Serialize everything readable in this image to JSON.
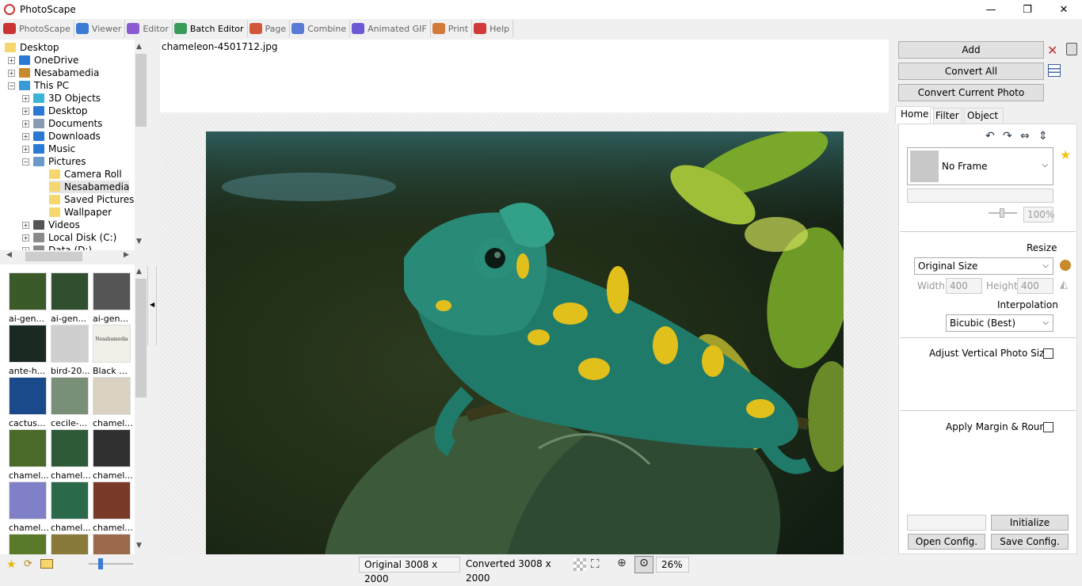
{
  "window": {
    "title": "PhotoScape",
    "minimize_glyph": "—",
    "maximize_glyph": "❐",
    "close_glyph": "✕"
  },
  "tabs": [
    {
      "label": "PhotoScape",
      "icon": "photoscape-icon",
      "color": "#cc3333"
    },
    {
      "label": "Viewer",
      "icon": "viewer-icon",
      "color": "#3a7bd5"
    },
    {
      "label": "Editor",
      "icon": "editor-icon",
      "color": "#8a5bd1"
    },
    {
      "label": "Batch Editor",
      "icon": "batch-editor-icon",
      "color": "#3a9b5a"
    },
    {
      "label": "Page",
      "icon": "page-icon",
      "color": "#d1573a"
    },
    {
      "label": "Combine",
      "icon": "combine-icon",
      "color": "#5a7bd5"
    },
    {
      "label": "Animated GIF",
      "icon": "animated-gif-icon",
      "color": "#6a5ad5"
    },
    {
      "label": "Print",
      "icon": "print-icon",
      "color": "#d17a3a"
    },
    {
      "label": "Help",
      "icon": "help-icon",
      "color": "#d13a3a"
    }
  ],
  "active_tab": "Batch Editor",
  "folder_tree": [
    {
      "label": "Desktop",
      "level": 0,
      "icon": "folder-icon",
      "expander": ""
    },
    {
      "label": "OneDrive",
      "level": 1,
      "icon": "cloud-icon",
      "expander": "+"
    },
    {
      "label": "Nesabamedia",
      "level": 1,
      "icon": "user-icon",
      "expander": "+"
    },
    {
      "label": "This PC",
      "level": 1,
      "icon": "computer-icon",
      "expander": "−"
    },
    {
      "label": "3D Objects",
      "level": 2,
      "icon": "3d-objects-icon",
      "expander": "+"
    },
    {
      "label": "Desktop",
      "level": 2,
      "icon": "desktop-icon",
      "expander": "+"
    },
    {
      "label": "Documents",
      "level": 2,
      "icon": "documents-icon",
      "expander": "+"
    },
    {
      "label": "Downloads",
      "level": 2,
      "icon": "downloads-icon",
      "expander": "+"
    },
    {
      "label": "Music",
      "level": 2,
      "icon": "music-icon",
      "expander": "+"
    },
    {
      "label": "Pictures",
      "level": 2,
      "icon": "pictures-icon",
      "expander": "−"
    },
    {
      "label": "Camera Roll",
      "level": 3,
      "icon": "folder-icon",
      "expander": ""
    },
    {
      "label": "Nesabamedia",
      "level": 3,
      "icon": "folder-icon",
      "expander": "",
      "selected": true
    },
    {
      "label": "Saved Pictures",
      "level": 3,
      "icon": "folder-icon",
      "expander": ""
    },
    {
      "label": "Wallpaper",
      "level": 3,
      "icon": "folder-icon",
      "expander": ""
    },
    {
      "label": "Videos",
      "level": 2,
      "icon": "videos-icon",
      "expander": "+"
    },
    {
      "label": "Local Disk (C:)",
      "level": 2,
      "icon": "drive-icon",
      "expander": "+"
    },
    {
      "label": "Data (D:)",
      "level": 2,
      "icon": "drive-icon",
      "expander": "+"
    }
  ],
  "thumbnails": [
    {
      "label": "ai-gen...",
      "tone": "#3b5a2a"
    },
    {
      "label": "ai-gen...",
      "tone": "#2f4f2f"
    },
    {
      "label": "ai-gen...",
      "tone": "#555555"
    },
    {
      "label": "ante-h...",
      "tone": "#1a2a22"
    },
    {
      "label": "bird-20...",
      "tone": "#cfcfcf"
    },
    {
      "label": "Black ...",
      "tone": "#f2efe8",
      "caption": "Nesabamedia"
    },
    {
      "label": "cactus...",
      "tone": "#1a4a8a"
    },
    {
      "label": "cecile-...",
      "tone": "#7a8f78"
    },
    {
      "label": "chamel...",
      "tone": "#d9d2c2"
    },
    {
      "label": "chamel...",
      "tone": "#4a6a2a"
    },
    {
      "label": "chamel...",
      "tone": "#2e5a3a"
    },
    {
      "label": "chamel...",
      "tone": "#303030"
    },
    {
      "label": "chamel...",
      "tone": "#8080c8"
    },
    {
      "label": "chamel...",
      "tone": "#2a6a4a"
    },
    {
      "label": "chamel...",
      "tone": "#7a3a2a"
    },
    {
      "label": "",
      "tone": "#5a7a2a"
    },
    {
      "label": "",
      "tone": "#8a7a3a"
    },
    {
      "label": "",
      "tone": "#9a6a4a"
    }
  ],
  "preview": {
    "filename": "chameleon-4501712.jpg"
  },
  "status": {
    "original": "Original 3008 x 2000",
    "converted": "Converted 3008 x 2000",
    "zoom": "26%"
  },
  "right_panel": {
    "add_label": "Add",
    "convert_all_label": "Convert All",
    "convert_current_label": "Convert Current Photo",
    "tabs": [
      "Home",
      "Filter",
      "Object"
    ],
    "active_tab": "Home",
    "frame_value": "No Frame",
    "frame_opacity": "100%",
    "resize_label": "Resize",
    "resize_value": "Original Size",
    "width_label": "Width",
    "width_value": "400",
    "height_label": "Height",
    "height_value": "400",
    "interpolation_label": "Interpolation",
    "interpolation_value": "Bicubic (Best)",
    "adjust_vertical_label": "Adjust Vertical Photo Size",
    "apply_margin_label": "Apply Margin & Round",
    "initialize_label": "Initialize",
    "open_config_label": "Open Config.",
    "save_config_label": "Save Config."
  },
  "colors": {
    "accent_red": "#cc3333",
    "star_yellow": "#f0c419",
    "folder_yellow": "#f5d76e"
  }
}
